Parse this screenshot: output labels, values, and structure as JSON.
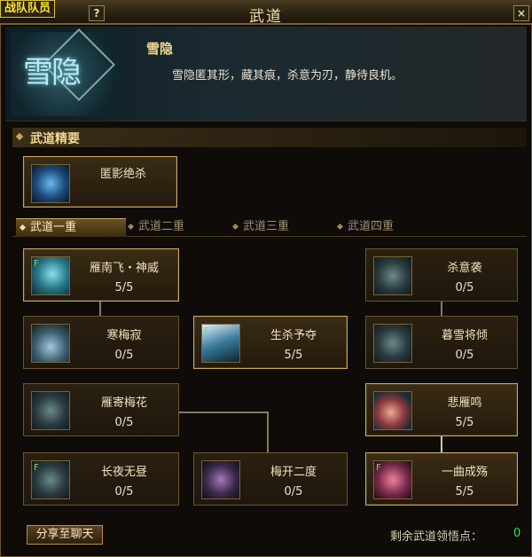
{
  "window": {
    "title": "武道",
    "tag": "战队队员",
    "help_icon": "?",
    "close_icon": "×",
    "mini_label": "F"
  },
  "skill": {
    "emblem_text": "雪隐",
    "name": "雪隐",
    "desc": "雪隐匿其形，藏其痕，杀意为刃，静待良机。"
  },
  "section": {
    "title": "武道精要",
    "essence": {
      "name": "匿影绝杀"
    }
  },
  "tabs": [
    {
      "label": "武道一重",
      "active": true
    },
    {
      "label": "武道二重",
      "active": false
    },
    {
      "label": "武道三重",
      "active": false
    },
    {
      "label": "武道四重",
      "active": false
    }
  ],
  "nodes": {
    "n1": {
      "name": "雁南飞・神威",
      "level": "5/5"
    },
    "n2": {
      "name": "杀意袭",
      "level": "0/5"
    },
    "n3": {
      "name": "寒梅寂",
      "level": "0/5"
    },
    "n4": {
      "name": "生杀予夺",
      "level": "5/5"
    },
    "n5": {
      "name": "暮雪将倾",
      "level": "0/5"
    },
    "n6": {
      "name": "雁寄梅花",
      "level": "0/5"
    },
    "n7": {
      "name": "悲雁鸣",
      "level": "5/5"
    },
    "n8": {
      "name": "长夜无昼",
      "level": "0/5"
    },
    "n9": {
      "name": "梅开二度",
      "level": "0/5"
    },
    "n10": {
      "name": "一曲成殇",
      "level": "5/5"
    }
  },
  "footer": {
    "share_label": "分享至聊天",
    "remain_label": "剩余武道领悟点：",
    "remain_value": "0"
  },
  "colors": {
    "gold": "#f0d890",
    "points_green": "#40e040"
  }
}
